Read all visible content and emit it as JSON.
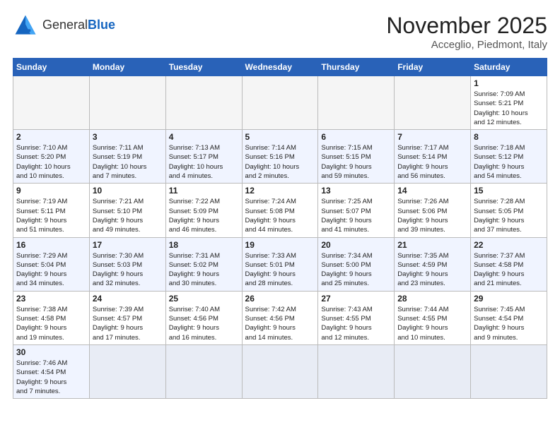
{
  "logo": {
    "text_general": "General",
    "text_blue": "Blue"
  },
  "title": "November 2025",
  "location": "Acceglio, Piedmont, Italy",
  "weekdays": [
    "Sunday",
    "Monday",
    "Tuesday",
    "Wednesday",
    "Thursday",
    "Friday",
    "Saturday"
  ],
  "weeks": [
    [
      {
        "day": "",
        "info": ""
      },
      {
        "day": "",
        "info": ""
      },
      {
        "day": "",
        "info": ""
      },
      {
        "day": "",
        "info": ""
      },
      {
        "day": "",
        "info": ""
      },
      {
        "day": "",
        "info": ""
      },
      {
        "day": "1",
        "info": "Sunrise: 7:09 AM\nSunset: 5:21 PM\nDaylight: 10 hours\nand 12 minutes."
      }
    ],
    [
      {
        "day": "2",
        "info": "Sunrise: 7:10 AM\nSunset: 5:20 PM\nDaylight: 10 hours\nand 10 minutes."
      },
      {
        "day": "3",
        "info": "Sunrise: 7:11 AM\nSunset: 5:19 PM\nDaylight: 10 hours\nand 7 minutes."
      },
      {
        "day": "4",
        "info": "Sunrise: 7:13 AM\nSunset: 5:17 PM\nDaylight: 10 hours\nand 4 minutes."
      },
      {
        "day": "5",
        "info": "Sunrise: 7:14 AM\nSunset: 5:16 PM\nDaylight: 10 hours\nand 2 minutes."
      },
      {
        "day": "6",
        "info": "Sunrise: 7:15 AM\nSunset: 5:15 PM\nDaylight: 9 hours\nand 59 minutes."
      },
      {
        "day": "7",
        "info": "Sunrise: 7:17 AM\nSunset: 5:14 PM\nDaylight: 9 hours\nand 56 minutes."
      },
      {
        "day": "8",
        "info": "Sunrise: 7:18 AM\nSunset: 5:12 PM\nDaylight: 9 hours\nand 54 minutes."
      }
    ],
    [
      {
        "day": "9",
        "info": "Sunrise: 7:19 AM\nSunset: 5:11 PM\nDaylight: 9 hours\nand 51 minutes."
      },
      {
        "day": "10",
        "info": "Sunrise: 7:21 AM\nSunset: 5:10 PM\nDaylight: 9 hours\nand 49 minutes."
      },
      {
        "day": "11",
        "info": "Sunrise: 7:22 AM\nSunset: 5:09 PM\nDaylight: 9 hours\nand 46 minutes."
      },
      {
        "day": "12",
        "info": "Sunrise: 7:24 AM\nSunset: 5:08 PM\nDaylight: 9 hours\nand 44 minutes."
      },
      {
        "day": "13",
        "info": "Sunrise: 7:25 AM\nSunset: 5:07 PM\nDaylight: 9 hours\nand 41 minutes."
      },
      {
        "day": "14",
        "info": "Sunrise: 7:26 AM\nSunset: 5:06 PM\nDaylight: 9 hours\nand 39 minutes."
      },
      {
        "day": "15",
        "info": "Sunrise: 7:28 AM\nSunset: 5:05 PM\nDaylight: 9 hours\nand 37 minutes."
      }
    ],
    [
      {
        "day": "16",
        "info": "Sunrise: 7:29 AM\nSunset: 5:04 PM\nDaylight: 9 hours\nand 34 minutes."
      },
      {
        "day": "17",
        "info": "Sunrise: 7:30 AM\nSunset: 5:03 PM\nDaylight: 9 hours\nand 32 minutes."
      },
      {
        "day": "18",
        "info": "Sunrise: 7:31 AM\nSunset: 5:02 PM\nDaylight: 9 hours\nand 30 minutes."
      },
      {
        "day": "19",
        "info": "Sunrise: 7:33 AM\nSunset: 5:01 PM\nDaylight: 9 hours\nand 28 minutes."
      },
      {
        "day": "20",
        "info": "Sunrise: 7:34 AM\nSunset: 5:00 PM\nDaylight: 9 hours\nand 25 minutes."
      },
      {
        "day": "21",
        "info": "Sunrise: 7:35 AM\nSunset: 4:59 PM\nDaylight: 9 hours\nand 23 minutes."
      },
      {
        "day": "22",
        "info": "Sunrise: 7:37 AM\nSunset: 4:58 PM\nDaylight: 9 hours\nand 21 minutes."
      }
    ],
    [
      {
        "day": "23",
        "info": "Sunrise: 7:38 AM\nSunset: 4:58 PM\nDaylight: 9 hours\nand 19 minutes."
      },
      {
        "day": "24",
        "info": "Sunrise: 7:39 AM\nSunset: 4:57 PM\nDaylight: 9 hours\nand 17 minutes."
      },
      {
        "day": "25",
        "info": "Sunrise: 7:40 AM\nSunset: 4:56 PM\nDaylight: 9 hours\nand 16 minutes."
      },
      {
        "day": "26",
        "info": "Sunrise: 7:42 AM\nSunset: 4:56 PM\nDaylight: 9 hours\nand 14 minutes."
      },
      {
        "day": "27",
        "info": "Sunrise: 7:43 AM\nSunset: 4:55 PM\nDaylight: 9 hours\nand 12 minutes."
      },
      {
        "day": "28",
        "info": "Sunrise: 7:44 AM\nSunset: 4:55 PM\nDaylight: 9 hours\nand 10 minutes."
      },
      {
        "day": "29",
        "info": "Sunrise: 7:45 AM\nSunset: 4:54 PM\nDaylight: 9 hours\nand 9 minutes."
      }
    ],
    [
      {
        "day": "30",
        "info": "Sunrise: 7:46 AM\nSunset: 4:54 PM\nDaylight: 9 hours\nand 7 minutes."
      },
      {
        "day": "",
        "info": ""
      },
      {
        "day": "",
        "info": ""
      },
      {
        "day": "",
        "info": ""
      },
      {
        "day": "",
        "info": ""
      },
      {
        "day": "",
        "info": ""
      },
      {
        "day": "",
        "info": ""
      }
    ]
  ]
}
